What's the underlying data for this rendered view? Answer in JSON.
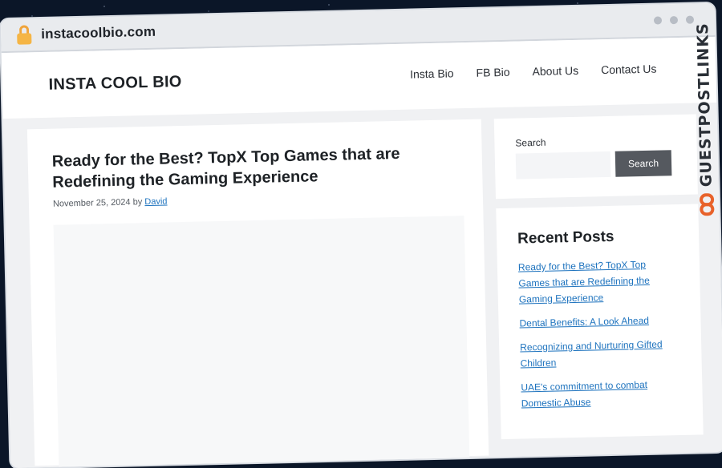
{
  "browser": {
    "url": "instacoolbio.com"
  },
  "header": {
    "site_title": "INSTA COOL BIO",
    "nav": [
      {
        "label": "Insta Bio"
      },
      {
        "label": "FB Bio"
      },
      {
        "label": "About Us"
      },
      {
        "label": "Contact Us"
      }
    ]
  },
  "article": {
    "title": "Ready for the Best? TopX Top Games that are Redefining the Gaming Experience",
    "date": "November 25, 2024",
    "by": "by",
    "author": "David"
  },
  "sidebar": {
    "search_label": "Search",
    "search_placeholder": "",
    "search_button": "Search",
    "recent_title": "Recent Posts",
    "recent_posts": [
      {
        "label": "Ready for the Best? TopX Top Games that are Redefining the Gaming Experience"
      },
      {
        "label": "Dental Benefits: A Look Ahead"
      },
      {
        "label": "Recognizing and Nurturing Gifted Children"
      },
      {
        "label": "UAE's commitment to combat Domestic Abuse"
      }
    ]
  },
  "watermark": {
    "text": "GUESTPOSTLINKS",
    "brand_color": "#e8622a"
  },
  "icons": {
    "lock": "lock-icon",
    "window_controls": "window-dot-icon"
  }
}
